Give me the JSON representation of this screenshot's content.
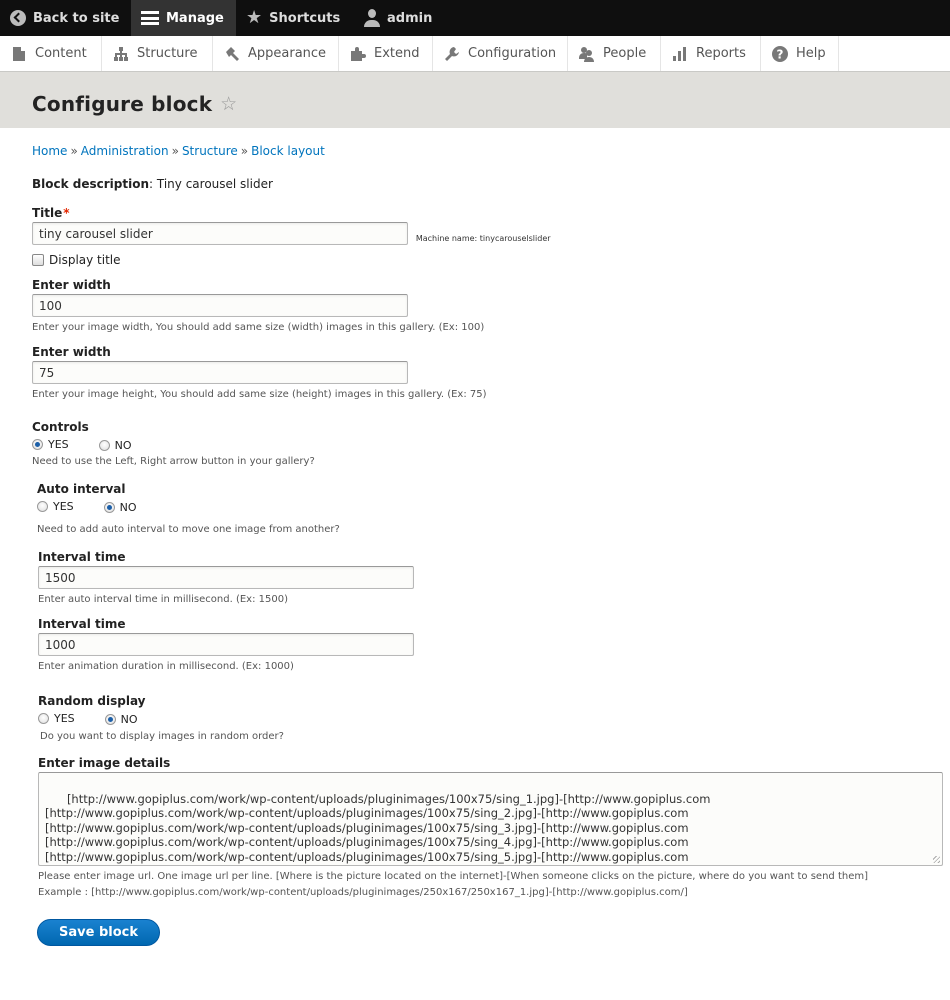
{
  "toolbar": {
    "back_to_site": "Back to site",
    "manage": "Manage",
    "shortcuts": "Shortcuts",
    "user": "admin"
  },
  "tray": [
    {
      "label": "Content",
      "icon": "content-icon"
    },
    {
      "label": "Structure",
      "icon": "structure-icon"
    },
    {
      "label": "Appearance",
      "icon": "appearance-icon"
    },
    {
      "label": "Extend",
      "icon": "extend-icon"
    },
    {
      "label": "Configuration",
      "icon": "configuration-icon"
    },
    {
      "label": "People",
      "icon": "people-icon"
    },
    {
      "label": "Reports",
      "icon": "reports-icon"
    },
    {
      "label": "Help",
      "icon": "help-icon"
    }
  ],
  "page": {
    "title": "Configure block",
    "breadcrumb": [
      "Home",
      "Administration",
      "Structure",
      "Block layout"
    ],
    "breadcrumb_sep": "»"
  },
  "form": {
    "block_desc_label": "Block description",
    "block_desc_value": ": Tiny carousel slider",
    "title_label": "Title",
    "title_required": "*",
    "title_value": "tiny carousel slider",
    "machine_name": "Machine name: tinycarouselslider",
    "display_title_label": "Display title",
    "display_title_checked": false,
    "width_label": "Enter width",
    "width_value": "100",
    "width_desc": "Enter your image width, You should add same size (width) images in this gallery. (Ex: 100)",
    "height_label": "Enter width",
    "height_value": "75",
    "height_desc": "Enter your image height, You should add same size (height) images in this gallery. (Ex: 75)",
    "controls_label": "Controls",
    "controls_selected": "YES",
    "controls_desc": "Need to use the Left, Right arrow button in your gallery?",
    "auto_interval_label": "Auto interval",
    "auto_interval_selected": "NO",
    "auto_interval_desc": "Need to add auto interval to move one image from another?",
    "interval_label": "Interval time",
    "interval_value": "1500",
    "interval_desc": "Enter auto interval time in millisecond. (Ex: 1500)",
    "duration_label": "Interval time",
    "duration_value": "1000",
    "duration_desc": "Enter animation duration in millisecond. (Ex: 1000)",
    "random_label": "Random display",
    "random_selected": "NO",
    "random_desc": "Do you want to display images in random order?",
    "yes": "YES",
    "no": "NO",
    "images_label": "Enter image details",
    "images_value": "[http://www.gopiplus.com/work/wp-content/uploads/pluginimages/100x75/sing_1.jpg]-[http://www.gopiplus.com\n[http://www.gopiplus.com/work/wp-content/uploads/pluginimages/100x75/sing_2.jpg]-[http://www.gopiplus.com\n[http://www.gopiplus.com/work/wp-content/uploads/pluginimages/100x75/sing_3.jpg]-[http://www.gopiplus.com\n[http://www.gopiplus.com/work/wp-content/uploads/pluginimages/100x75/sing_4.jpg]-[http://www.gopiplus.com\n[http://www.gopiplus.com/work/wp-content/uploads/pluginimages/100x75/sing_5.jpg]-[http://www.gopiplus.com",
    "images_desc": "Please enter image url. One image url per line. [Where is the picture located on the internet]-[When someone clicks on the picture, where do you want to send them]",
    "images_example": "Example : [http://www.gopiplus.com/work/wp-content/uploads/pluginimages/250x167/250x167_1.jpg]-[http://www.gopiplus.com/]",
    "save_label": "Save block"
  },
  "colors": {
    "link": "#0074bd",
    "primary_button": "#0074bd",
    "required": "#e32700",
    "toolbar_bg": "#0f0f0f",
    "header_bg": "#e0dfdb"
  }
}
